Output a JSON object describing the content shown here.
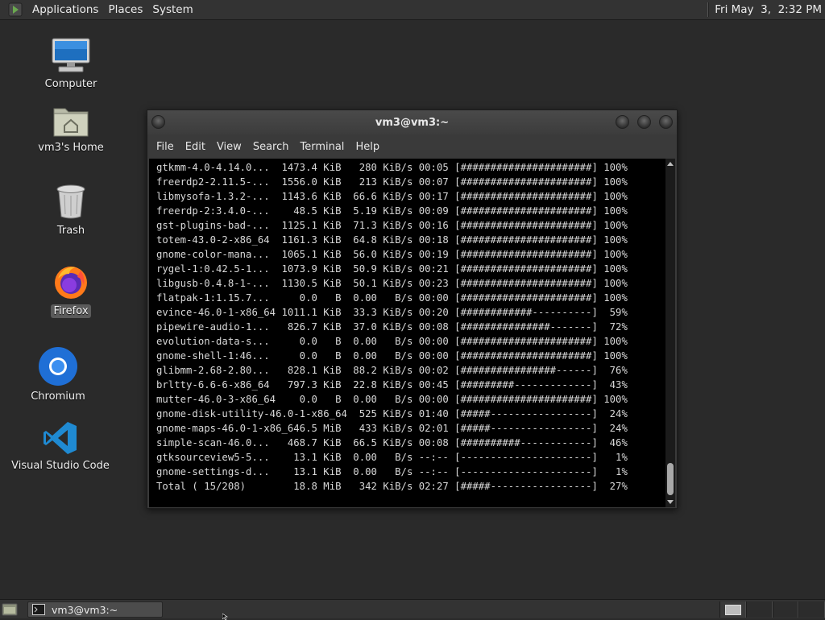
{
  "top_panel": {
    "menus": [
      "Applications",
      "Places",
      "System"
    ],
    "clock": "Fri May  3,  2:32 PM"
  },
  "desktop_icons": [
    {
      "label": "Computer",
      "icon": "computer-icon"
    },
    {
      "label": "vm3's Home",
      "icon": "home-folder-icon"
    },
    {
      "label": "Trash",
      "icon": "trash-icon"
    },
    {
      "label": "Firefox",
      "icon": "firefox-icon",
      "selected": true
    },
    {
      "label": "Chromium",
      "icon": "chromium-icon"
    },
    {
      "label": "Visual Studio Code",
      "icon": "vscode-icon"
    }
  ],
  "terminal": {
    "title": "vm3@vm3:~",
    "menu": [
      "File",
      "Edit",
      "View",
      "Search",
      "Terminal",
      "Help"
    ],
    "lines": [
      "gtkmm-4.0-4.14.0...  1473.4 KiB   280 KiB/s 00:05 [######################] 100%",
      "freerdp2-2.11.5-...  1556.0 KiB   213 KiB/s 00:07 [######################] 100%",
      "libmysofa-1.3.2-...  1143.6 KiB  66.6 KiB/s 00:17 [######################] 100%",
      "freerdp-2:3.4.0-...    48.5 KiB  5.19 KiB/s 00:09 [######################] 100%",
      "gst-plugins-bad-...  1125.1 KiB  71.3 KiB/s 00:16 [######################] 100%",
      "totem-43.0-2-x86_64  1161.3 KiB  64.8 KiB/s 00:18 [######################] 100%",
      "gnome-color-mana...  1065.1 KiB  56.0 KiB/s 00:19 [######################] 100%",
      "rygel-1:0.42.5-1...  1073.9 KiB  50.9 KiB/s 00:21 [######################] 100%",
      "libgusb-0.4.8-1-...  1130.5 KiB  50.1 KiB/s 00:23 [######################] 100%",
      "flatpak-1:1.15.7...     0.0   B  0.00   B/s 00:00 [######################] 100%",
      "evince-46.0-1-x86_64 1011.1 KiB  33.3 KiB/s 00:20 [############----------]  59%",
      "pipewire-audio-1...   826.7 KiB  37.0 KiB/s 00:08 [###############-------]  72%",
      "evolution-data-s...     0.0   B  0.00   B/s 00:00 [######################] 100%",
      "gnome-shell-1:46...     0.0   B  0.00   B/s 00:00 [######################] 100%",
      "glibmm-2.68-2.80...   828.1 KiB  88.2 KiB/s 00:02 [################------]  76%",
      "brltty-6.6-6-x86_64   797.3 KiB  22.8 KiB/s 00:45 [#########-------------]  43%",
      "mutter-46.0-3-x86_64    0.0   B  0.00   B/s 00:00 [######################] 100%",
      "gnome-disk-utility-46.0-1-x86_64  525 KiB/s 01:40 [#####-----------------]  24%",
      "gnome-maps-46.0-1-x86_646.5 MiB   433 KiB/s 02:01 [#####-----------------]  24%",
      "simple-scan-46.0...   468.7 KiB  66.5 KiB/s 00:08 [##########------------]  46%",
      "gtksourceview5-5...    13.1 KiB  0.00   B/s --:-- [----------------------]   1%",
      "gnome-settings-d...    13.1 KiB  0.00   B/s --:-- [----------------------]   1%",
      "Total ( 15/208)        18.8 MiB   342 KiB/s 02:27 [#####-----------------]  27%"
    ]
  },
  "bottom_panel": {
    "task_label": "vm3@vm3:~"
  }
}
